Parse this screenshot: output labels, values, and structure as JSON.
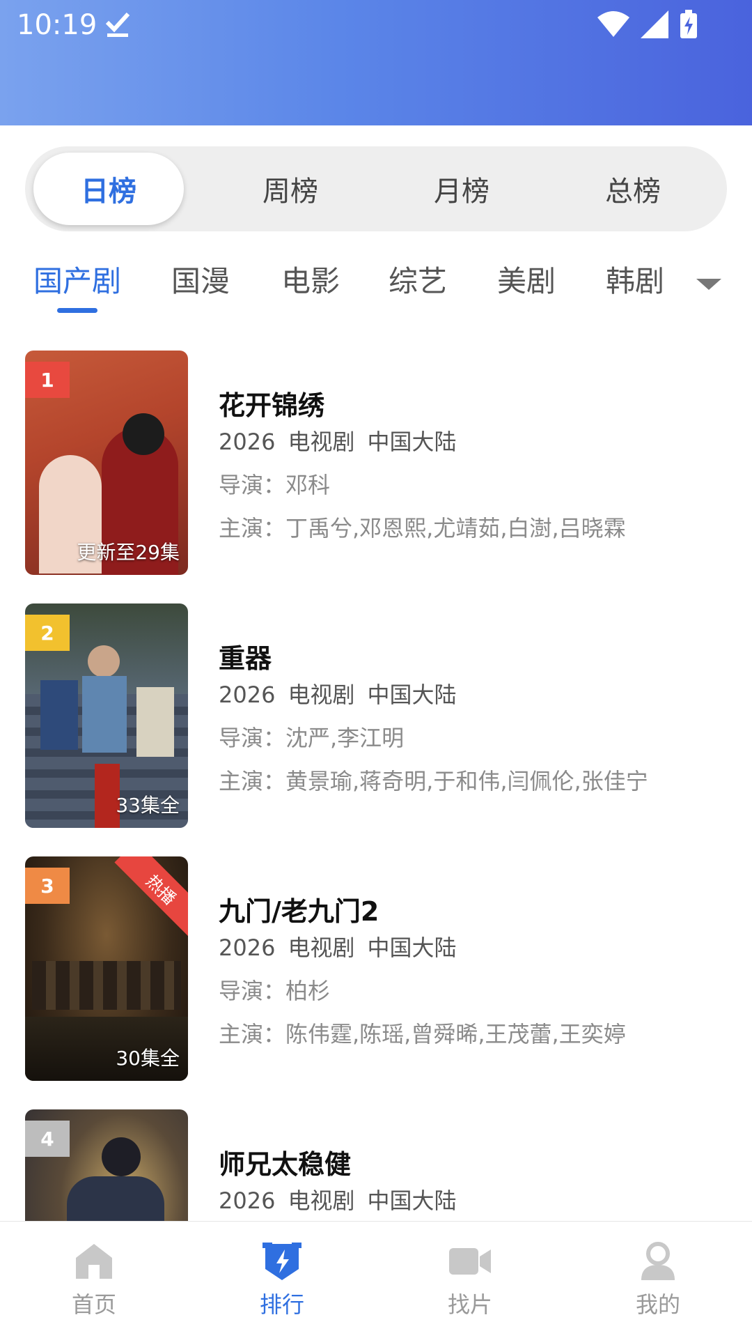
{
  "status_bar": {
    "time": "10:19"
  },
  "period_tabs": [
    {
      "label": "日榜",
      "active": true
    },
    {
      "label": "周榜",
      "active": false
    },
    {
      "label": "月榜",
      "active": false
    },
    {
      "label": "总榜",
      "active": false
    }
  ],
  "categories": [
    {
      "label": "国产剧",
      "active": true
    },
    {
      "label": "国漫",
      "active": false
    },
    {
      "label": "电影",
      "active": false
    },
    {
      "label": "综艺",
      "active": false
    },
    {
      "label": "美剧",
      "active": false
    },
    {
      "label": "韩剧",
      "active": false
    }
  ],
  "items": [
    {
      "rank": "1",
      "title": "花开锦绣",
      "year": "2026",
      "type": "电视剧",
      "region": "中国大陆",
      "director": "导演：邓科",
      "cast": "主演：丁禹兮,邓恩熙,尤靖茹,白澍,吕晓霖",
      "note": "更新至29集",
      "badge": ""
    },
    {
      "rank": "2",
      "title": "重器",
      "year": "2026",
      "type": "电视剧",
      "region": "中国大陆",
      "director": "导演：沈严,李江明",
      "cast": "主演：黄景瑜,蒋奇明,于和伟,闫佩伦,张佳宁",
      "note": "33集全",
      "badge": ""
    },
    {
      "rank": "3",
      "title": "九门/老九门2",
      "year": "2026",
      "type": "电视剧",
      "region": "中国大陆",
      "director": "导演：柏杉",
      "cast": "主演：陈伟霆,陈瑶,曾舜晞,王茂蕾,王奕婷",
      "note": "30集全",
      "badge": "热播"
    },
    {
      "rank": "4",
      "title": "师兄太稳健",
      "year": "2026",
      "type": "电视剧",
      "region": "中国大陆",
      "director": "",
      "cast": "",
      "note": "",
      "badge": ""
    }
  ],
  "tab_bar": [
    {
      "label": "首页",
      "icon": "home-icon",
      "active": false
    },
    {
      "label": "排行",
      "icon": "ranking-icon",
      "active": true
    },
    {
      "label": "找片",
      "icon": "video-camera-icon",
      "active": false
    },
    {
      "label": "我的",
      "icon": "user-icon",
      "active": false
    }
  ],
  "colors": {
    "accent": "#2f6fe0",
    "rank1": "#e8493f",
    "rank2": "#f2c12e",
    "rank3": "#ef8a45",
    "rank4": "#bdbdbd",
    "header_gradient_start": "#7aa2ee",
    "header_gradient_end": "#4a63dd"
  }
}
